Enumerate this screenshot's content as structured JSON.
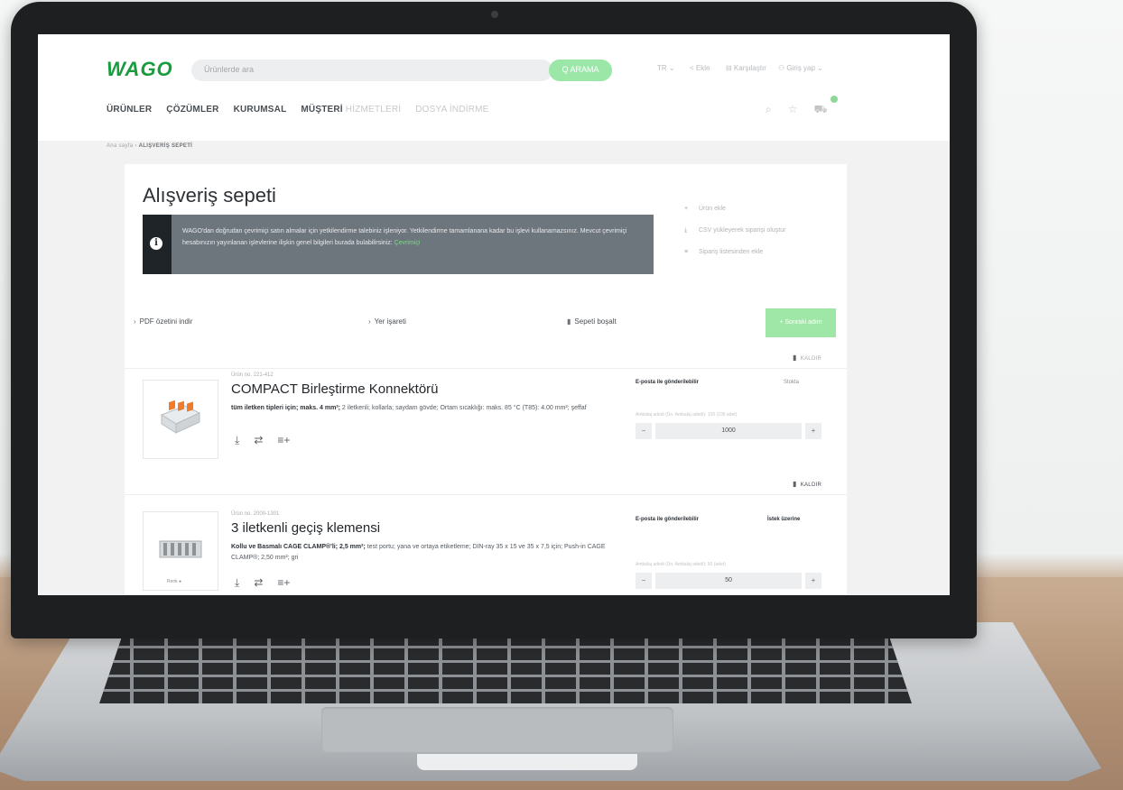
{
  "header": {
    "logo": "WAGO",
    "search_placeholder": "Ürünlerde ara",
    "search_button": "Q ARAMA",
    "utility": {
      "language": "TR ⌄",
      "share": "< Ekle",
      "compare": "⊟ Karşılaştır",
      "account": "⚇ Giriş yap ⌄"
    }
  },
  "nav": {
    "items": [
      "ÜRÜNLER",
      "ÇÖZÜMLER",
      "KURUMSAL",
      "MÜŞTERİ"
    ],
    "faded": [
      "HİZMETLERİ",
      "DOSYA İNDİRME"
    ]
  },
  "breadcrumb": {
    "home": "Ana sayfa",
    "separator": "›",
    "current": "ALIŞVERİŞ SEPETİ"
  },
  "page": {
    "title": "Alışveriş sepeti",
    "info_text": "WAGO'dan doğrudan çevrimiçi satın almalar için yetkilendirme talebiniz işleniyor. Yetkilendirme tamamlanana kadar bu işlevi kullanamazsınız. Mevcut çevrimiçi hesabınızın yayınlanan işlevlerine ilişkin genel bilgileri burada bulabilirsiniz:",
    "info_link": "Çevrimiçi",
    "side_links": [
      {
        "icon": "+",
        "label": "Ürün ekle"
      },
      {
        "icon": "⤓",
        "label": "CSV yükleyerek siparişi oluştur"
      },
      {
        "icon": "≡",
        "label": "Sipariş listesinden ekle"
      }
    ]
  },
  "actions": {
    "pdf": "PDF özetini indir",
    "bookmark": "Yer işareti",
    "clear": "Sepeti boşalt",
    "next": "+ Sonraki adım"
  },
  "items": [
    {
      "sku": "Ürün no. 221-412",
      "name": "COMPACT Birleştirme Konnektörü",
      "desc_bold": "tüm iletken tipleri için; maks. 4 mm²;",
      "desc_rest": " 2 iletkenli; kollarla; saydam gövde; Ortam sıcaklığı: maks. 85 °C (T85): 4.00 mm²; şeffaf",
      "ship_label": "E-posta ile gönderilebilir",
      "ship_option": "Stokta",
      "qty_label": "Ambalaj adedi (Ün. Ambalaj adedi): 100 (100 adet)",
      "qty": "1000",
      "remove": "KALDIR"
    },
    {
      "sku": "Ürün no. 2000-1301",
      "name": "3 iletkenli geçiş klemensi",
      "desc_bold": "Kollu ve Basmalı CAGE CLAMP®'li; 2,5 mm²;",
      "desc_rest": " test portu; yana ve ortaya etiketleme; DIN-ray 35 x 15 ve 35 x 7,5 için; Push-in CAGE CLAMP®; 2,50 mm²; gri",
      "ship_label": "E-posta ile gönderilebilir",
      "ship_option": "İstek üzerine",
      "qty_label": "Ambalaj adedi (Ün. Ambalaj adedi): 50 (adet)",
      "qty": "50",
      "remove": "KALDIR",
      "thumb_label": "Renk ●"
    }
  ],
  "stepper": {
    "minus": "−",
    "plus": "+"
  },
  "icons": {
    "download": "⤓",
    "compare": "⇄",
    "list": "≡+",
    "search": "⌕",
    "bookmark": "☆",
    "cart": "🛒",
    "trash": "🗑",
    "info": "i"
  },
  "colors": {
    "accent": "#1a9c3e",
    "accent_light": "#9ee7a6",
    "info_bg": "#6e767d",
    "info_dark": "#1f2428"
  }
}
